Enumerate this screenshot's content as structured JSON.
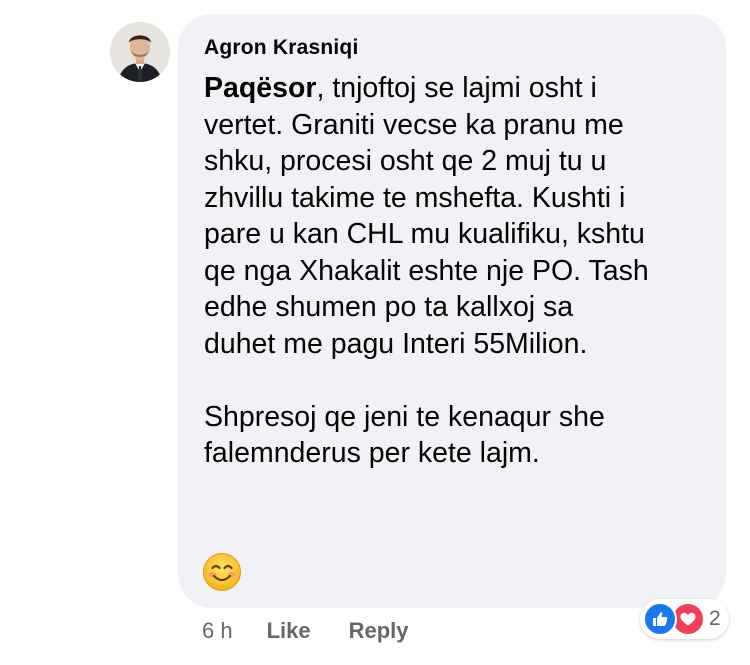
{
  "comment": {
    "author": "Agron Krasniqi",
    "mention": "Paqësor",
    "lines": [
      ", tnjoftoj se lajmi osht i",
      "vertet. Graniti vecse ka pranu me",
      "shku, procesi osht qe 2 muj tu u",
      "zhvillu takime te mshefta. Kushti i",
      "pare u kan CHL mu kualifiku, kshtu",
      "qe nga Xhakalit eshte nje PO. Tash",
      "edhe shumen po ta kallxoj sa",
      "duhet me pagu Interi 55Milion."
    ],
    "closing_lines": [
      "Shpresoj qe jeni te kenaqur she",
      "falemnderus per kete lajm."
    ],
    "emoji": "smiling-face-emoji"
  },
  "actions": {
    "time": "6 h",
    "like_label": "Like",
    "reply_label": "Reply"
  },
  "reactions": {
    "types": [
      "like",
      "love"
    ],
    "count": "2",
    "colors": {
      "like": "#1877f2",
      "love": "#f33e58"
    }
  },
  "colors": {
    "bubble_bg": "#f0f2f5",
    "text": "#050505",
    "secondary_text": "#65676b"
  }
}
